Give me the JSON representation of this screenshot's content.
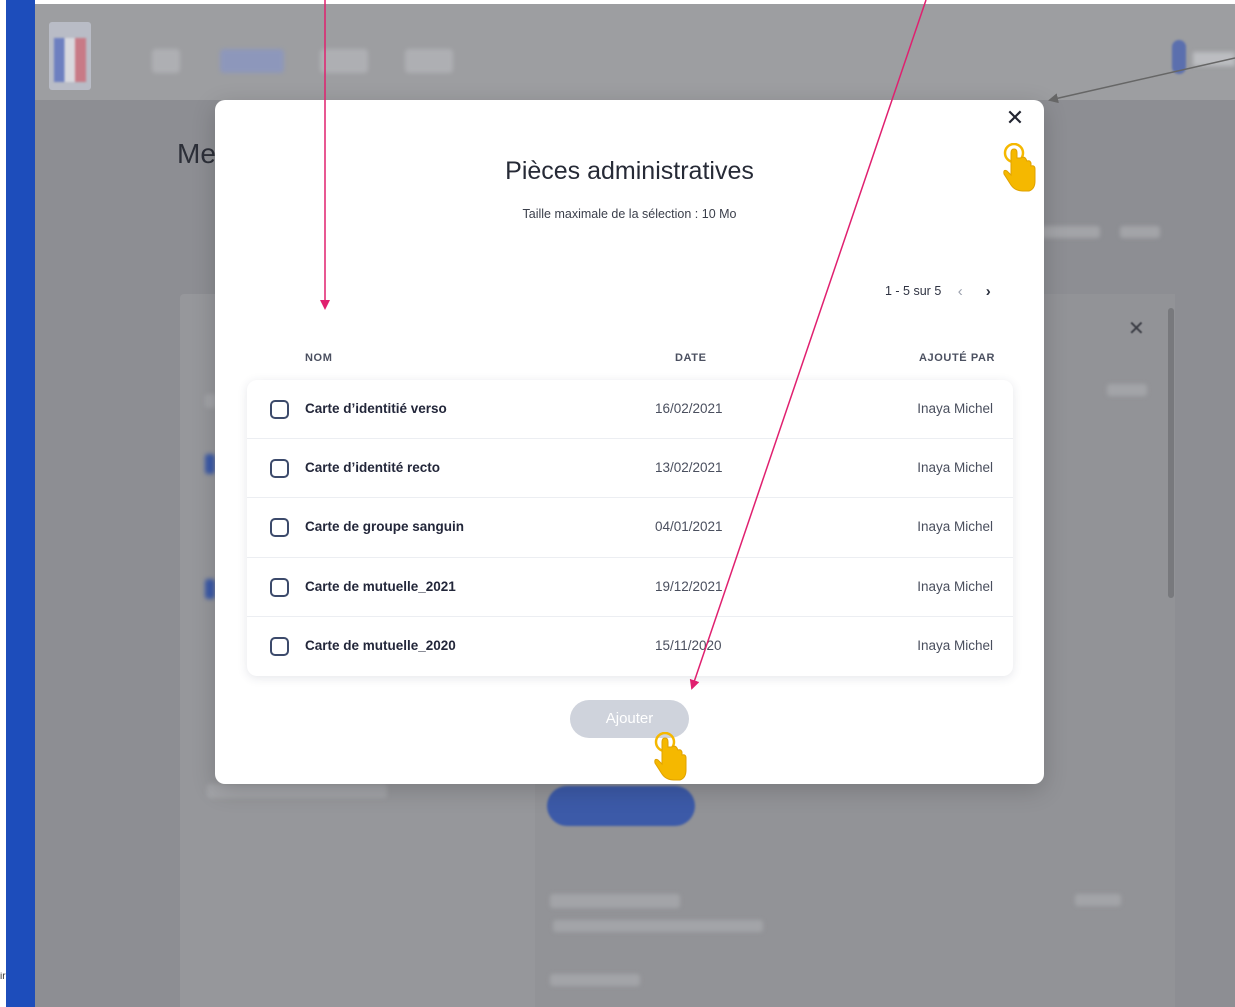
{
  "modal": {
    "title": "Pièces administratives",
    "subtitle": "Taille maximale de la sélection : 10 Mo",
    "close_icon": "close-icon",
    "pagination": {
      "range": "1 - 5 sur 5",
      "prev_icon": "chevron-left-icon",
      "next_icon": "chevron-right-icon"
    },
    "columns": {
      "name": "NOM",
      "date": "DATE",
      "added_by": "AJOUTÉ PAR"
    },
    "files": [
      {
        "name": "Carte d’identitié verso",
        "date": "16/02/2021",
        "added_by": "Inaya Michel",
        "checked": false
      },
      {
        "name": "Carte d’identité recto",
        "date": "13/02/2021",
        "added_by": "Inaya Michel",
        "checked": false
      },
      {
        "name": "Carte de groupe sanguin",
        "date": "04/01/2021",
        "added_by": "Inaya Michel",
        "checked": false
      },
      {
        "name": "Carte de mutuelle_2021",
        "date": "19/12/2021",
        "added_by": "Inaya Michel",
        "checked": false
      },
      {
        "name": "Carte de mutuelle_2020",
        "date": "15/11/2020",
        "added_by": "Inaya Michel",
        "checked": false
      }
    ],
    "add_button": "Ajouter",
    "add_button_disabled": true
  },
  "background": {
    "page_title_fragment": "Me",
    "panel_close_icon": "close-icon"
  },
  "annotations": {
    "arrow_color": "#e0206f",
    "arrow_gray": "#666666",
    "hand_icon": "pointing-hand-icon",
    "hand_color": "#f5b800"
  },
  "colors": {
    "accent_blue": "#1d4dbb",
    "overlay": "#8d8e93",
    "disabled_button": "#cfd3dc",
    "checkbox_border": "#3c4a6b"
  }
}
